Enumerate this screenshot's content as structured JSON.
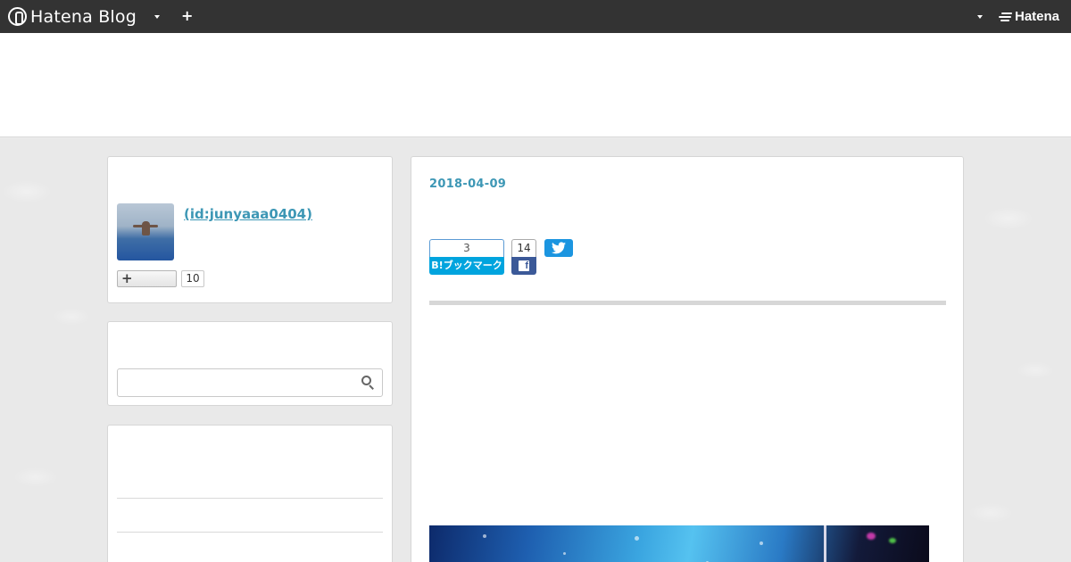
{
  "topbar": {
    "logo_text": "Hatena Blog",
    "hatena_text": "Hatena"
  },
  "profile": {
    "name": " (id:junyaaa0404)",
    "follow_count": "10"
  },
  "search": {
    "placeholder": "",
    "value": ""
  },
  "post": {
    "date": "2018-04-09",
    "hatena_bookmark_count": "3",
    "hatena_bookmark_label": "B!ブックマーク",
    "facebook_count": "14"
  },
  "colors": {
    "topbar_bg": "#333333",
    "link_accent": "#3d97b5",
    "hatena_bookmark": "#00a4de",
    "facebook": "#3b5998",
    "twitter": "#1b95e0"
  },
  "icons": {
    "topbar_logo": "hatena-blog-logo-icon",
    "topbar_dropdown": "caret-down-icon",
    "topbar_add": "plus-icon",
    "hatena_logo": "hatena-logo-icon",
    "search": "search-icon",
    "follow": "plus-icon",
    "facebook": "facebook-icon",
    "twitter": "twitter-icon"
  }
}
